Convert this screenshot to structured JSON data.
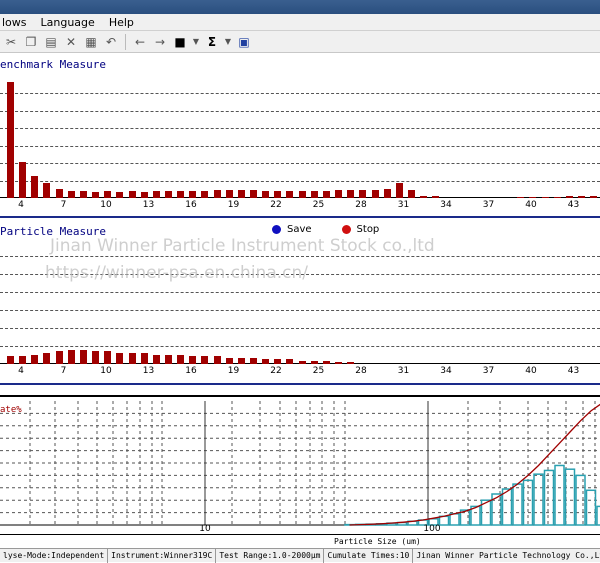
{
  "menu": {
    "items": [
      "lows",
      "Language",
      "Help"
    ]
  },
  "toolbar": {
    "icons": [
      "scissors-icon",
      "copy-icon",
      "paste-icon",
      "delete-icon",
      "properties-icon",
      "undo-icon",
      "back-arrow-icon",
      "forward-arrow-icon",
      "camera-icon",
      "dropdown-icon",
      "sigma-icon",
      "dropdown-icon",
      "report-icon"
    ]
  },
  "panels": {
    "benchmark": {
      "title": "enchmark Measure"
    },
    "particle": {
      "title": "Particle Measure"
    },
    "distribution": {
      "series_label": "ate%",
      "x_axis_label": "Particle Size (um)"
    }
  },
  "legend": {
    "save": {
      "label": "Save",
      "color": "#1010c0"
    },
    "stop": {
      "label": "Stop",
      "color": "#d01010"
    }
  },
  "watermark": {
    "line1": "Jinan Winner Particle   Instrument Stock co.,ltd",
    "line2": "https://winner-psa.en.china.cn/"
  },
  "status": {
    "mode": "lyse-Mode:Independent",
    "instrument": "Instrument:Winner319C",
    "range": "Test Range:1.0-2000µm",
    "cumulate": "Cumulate Times:10",
    "company": "Jinan Winner Particle Technology Co.,Ltd"
  },
  "colors": {
    "bar": "#a00000",
    "divider": "#1a2a8a",
    "hist": "#2aa0b0",
    "curve": "#a00000"
  },
  "chart_data": [
    {
      "type": "bar",
      "title": "enchmark Measure",
      "x_ticks": [
        "4",
        "7",
        "10",
        "13",
        "16",
        "19",
        "22",
        "25",
        "28",
        "31",
        "34",
        "37",
        "40",
        "43"
      ],
      "values": [
        100,
        31,
        19,
        13,
        8,
        6,
        6,
        5,
        6,
        5,
        6,
        5,
        6,
        6,
        6,
        6,
        6,
        7,
        7,
        7,
        7,
        6,
        6,
        6,
        6,
        6,
        6,
        7,
        7,
        7,
        7,
        8,
        13,
        7,
        2,
        2,
        0,
        0,
        0,
        0,
        0,
        0,
        1,
        1,
        1,
        1,
        2,
        2,
        2
      ],
      "ylim": [
        0,
        105
      ]
    },
    {
      "type": "bar",
      "title": "Particle Measure",
      "x_ticks": [
        "4",
        "7",
        "10",
        "13",
        "16",
        "19",
        "22",
        "25",
        "28",
        "31",
        "34",
        "37",
        "40",
        "43"
      ],
      "values": [
        5,
        5,
        6,
        7,
        8,
        9,
        9,
        8,
        8,
        7,
        7,
        7,
        6,
        6,
        6,
        5,
        5,
        5,
        4,
        4,
        4,
        3,
        3,
        3,
        2,
        2,
        2,
        1,
        1,
        0,
        0,
        0,
        0,
        0,
        0,
        0,
        0,
        0,
        0,
        0,
        0,
        0,
        0,
        0,
        0,
        0,
        0,
        0,
        0
      ],
      "ylim": [
        0,
        80
      ]
    },
    {
      "type": "bar",
      "series": [
        {
          "name": "ate%",
          "type": "line"
        }
      ],
      "x_ticks": [
        "10",
        "100"
      ],
      "xlabel": "Particle Size (um)",
      "hist_values": [
        0.3,
        0.5,
        0.7,
        1,
        1.5,
        2,
        3,
        4,
        5,
        7,
        9,
        12,
        15,
        20,
        25,
        29,
        33,
        36,
        41,
        44,
        48,
        45,
        40,
        28,
        15
      ],
      "curve_values": [
        0,
        0.3,
        0.6,
        1,
        1.5,
        2.2,
        3,
        4,
        5.5,
        7,
        9,
        11,
        14,
        18,
        22,
        27,
        33,
        40,
        48,
        57,
        66,
        75,
        84,
        92,
        98
      ],
      "ylim": [
        0,
        100
      ]
    }
  ]
}
